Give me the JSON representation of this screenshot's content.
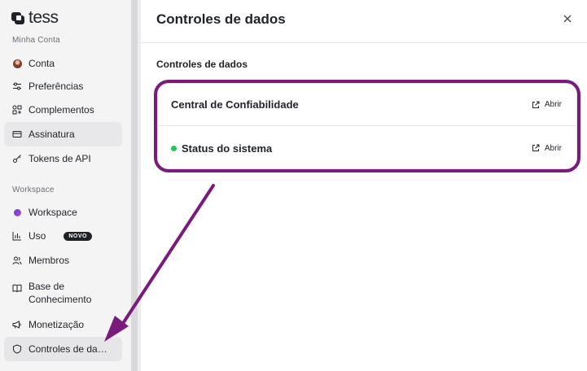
{
  "app": {
    "logo_text": "tess"
  },
  "sidebar": {
    "account_section_label": "Minha Conta",
    "account_items": [
      {
        "label": "Conta",
        "icon": "avatar-icon"
      },
      {
        "label": "Preferências",
        "icon": "sliders-icon"
      },
      {
        "label": "Complementos",
        "icon": "addons-icon"
      },
      {
        "label": "Assinatura",
        "icon": "card-icon"
      },
      {
        "label": "Tokens de API",
        "icon": "key-icon"
      }
    ],
    "workspace_section_label": "Workspace",
    "workspace_items": [
      {
        "label": "Workspace",
        "icon": "workspace-icon"
      },
      {
        "label": "Uso",
        "icon": "bar-chart-icon",
        "badge": "NOVO"
      },
      {
        "label": "Membros",
        "icon": "users-icon"
      },
      {
        "label": "Base de Conhecimento",
        "icon": "book-icon"
      },
      {
        "label": "Monetização",
        "icon": "megaphone-icon"
      },
      {
        "label": "Controles de dados",
        "icon": "shield-icon"
      }
    ]
  },
  "main": {
    "title": "Controles de dados",
    "section_title": "Controles de dados",
    "rows": [
      {
        "title": "Central de Confiabilidade",
        "action": "Abrir"
      },
      {
        "title": "Status do sistema",
        "action": "Abrir",
        "status_color": "#22c55e"
      }
    ]
  },
  "colors": {
    "highlight": "#7a1a7a",
    "status_ok": "#22c55e"
  }
}
